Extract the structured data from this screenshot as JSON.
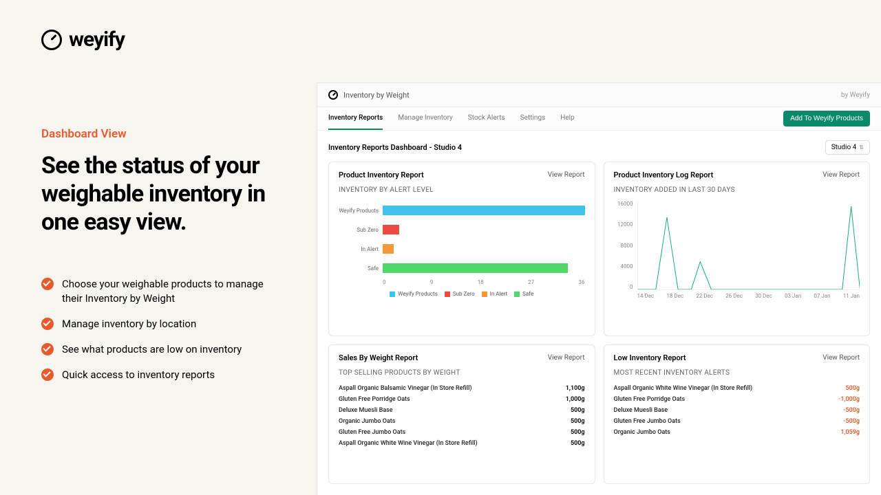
{
  "brand": "weyify",
  "left": {
    "eyebrow": "Dashboard View",
    "hero": "See the status of your weighable inventory in one easy view.",
    "bullets": [
      "Choose your weighable products to manage their Inventory by Weight",
      "Manage inventory by location",
      "See what products are low on inventory",
      "Quick access to inventory reports"
    ]
  },
  "app": {
    "title": "Inventory by Weight",
    "by": "by Weyify",
    "tabs": [
      "Inventory Reports",
      "Manage Inventory",
      "Stock Alerts",
      "Settings",
      "Help"
    ],
    "active_tab": 0,
    "add_button": "Add To Weyify Products",
    "dash_title": "Inventory Reports Dashboard - Studio 4",
    "location": "Studio 4",
    "view_report": "View Report"
  },
  "card1": {
    "title": "Product Inventory Report",
    "sub": "INVENTORY BY ALERT LEVEL"
  },
  "card2": {
    "title": "Product Inventory Log Report",
    "sub": "INVENTORY ADDED IN LAST 30 DAYS"
  },
  "card3": {
    "title": "Sales By Weight Report",
    "sub": "TOP SELLING PRODUCTS BY WEIGHT",
    "rows": [
      {
        "name": "Aspall Organic Balsamic Vinegar (In Store Refill)",
        "val": "1,100g"
      },
      {
        "name": "Gluten Free Porridge Oats",
        "val": "1,000g"
      },
      {
        "name": "Deluxe Muesli Base",
        "val": "500g"
      },
      {
        "name": "Organic Jumbo Oats",
        "val": "500g"
      },
      {
        "name": "Gluten Free Jumbo Oats",
        "val": "500g"
      },
      {
        "name": "Aspall Organic White Wine Vinegar (In Store Refill)",
        "val": "500g"
      }
    ]
  },
  "card4": {
    "title": "Low Inventory Report",
    "sub": "MOST RECENT INVENTORY ALERTS",
    "rows": [
      {
        "name": "Aspall Organic White Wine Vinegar (In Store Refill)",
        "val": "500g"
      },
      {
        "name": "Gluten Free Porridge Oats",
        "val": "-1,000g"
      },
      {
        "name": "Deluxe Muesli Base",
        "val": "-500g"
      },
      {
        "name": "Gluten Free Jumbo Oats",
        "val": "-500g"
      },
      {
        "name": "Organic Jumbo Oats",
        "val": "1,059g"
      }
    ]
  },
  "chart_data": [
    {
      "type": "bar",
      "title": "Inventory by Alert Level",
      "xlabel": "",
      "ylabel": "",
      "xlim": [
        0,
        36
      ],
      "categories": [
        "Weyify Products",
        "Sub Zero",
        "In Alert",
        "Safe"
      ],
      "values": [
        36,
        3,
        2,
        33
      ],
      "colors": [
        "#3fc3ea",
        "#ea4a3f",
        "#f29a3a",
        "#4fd96a"
      ],
      "x_ticks": [
        0,
        9,
        18,
        27,
        36
      ],
      "legend": [
        "Weyify Products",
        "Sub Zero",
        "In Alert",
        "Safe"
      ]
    },
    {
      "type": "line",
      "title": "Inventory Added in Last 30 Days",
      "ylim": [
        0,
        16000
      ],
      "y_ticks": [
        0,
        4000,
        8000,
        12000,
        16000
      ],
      "x_ticks": [
        "14 Dec",
        "18 Dec",
        "22 Dec",
        "26 Dec",
        "30 Dec",
        "03 Jan",
        "07 Jan",
        "11 Jan"
      ],
      "series": [
        {
          "name": "added",
          "color": "#1aa888",
          "points": [
            [
              0,
              0
            ],
            [
              0.08,
              0
            ],
            [
              0.13,
              13000
            ],
            [
              0.18,
              0
            ],
            [
              0.24,
              0
            ],
            [
              0.28,
              5000
            ],
            [
              0.33,
              0
            ],
            [
              0.88,
              0
            ],
            [
              0.92,
              0
            ],
            [
              0.96,
              15000
            ],
            [
              1.0,
              0
            ]
          ]
        }
      ]
    }
  ]
}
